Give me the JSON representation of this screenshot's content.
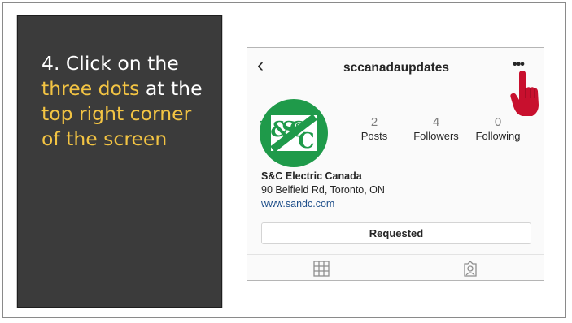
{
  "instruction": {
    "step_prefix": "4. Click on the ",
    "highlight_1": "three dots",
    "middle": " at the ",
    "highlight_2": "top right corner of the screen"
  },
  "profile": {
    "back_icon": "chevron-left-icon",
    "username": "sccanadaupdates",
    "more_icon": "more-dots-icon",
    "avatar_text": "S&C",
    "stats": [
      {
        "value": "2",
        "label": "Posts"
      },
      {
        "value": "4",
        "label": "Followers"
      },
      {
        "value": "0",
        "label": "Following"
      }
    ],
    "bio": {
      "name": "S&C Electric Canada",
      "address": "90 Belfield Rd, Toronto, ON",
      "website": "www.sandc.com"
    },
    "button_label": "Requested",
    "tabs": [
      "grid-icon",
      "tagged-icon"
    ]
  },
  "colors": {
    "panel_bg": "#3b3b3b",
    "highlight": "#f3c443",
    "avatar_green": "#1f9a4a",
    "pointer_red": "#c8102e",
    "link_blue": "#1f4f8a"
  }
}
